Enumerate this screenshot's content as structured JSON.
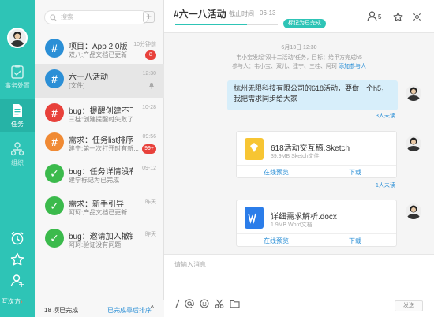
{
  "rail": {
    "nav": [
      {
        "label": "事务处置"
      },
      {
        "label": "任务"
      },
      {
        "label": "组织"
      }
    ],
    "footer_text": "互次方",
    "footer_arrow": "›",
    "accent": "#2ec4b6"
  },
  "list": {
    "search_placeholder": "搜索",
    "add_label": "+",
    "items": [
      {
        "icon": "#",
        "color": "#2b8fd6",
        "title": "项目：App 2.0版",
        "sub": "双八:产品文档已更新",
        "time": "10分钟前",
        "badge": "8"
      },
      {
        "icon": "#",
        "color": "#2b8fd6",
        "title": "六一八活动",
        "sub": "[文件]",
        "time": "12:30",
        "badge": ""
      },
      {
        "icon": "#",
        "color": "#e8413b",
        "title": "bug：提醒创建不了",
        "sub": "三桂:创建提醒时失败了...",
        "time": "10-28",
        "badge": ""
      },
      {
        "icon": "#",
        "color": "#f08a34",
        "title": "需求：任务list排序...",
        "sub": "建宁:第一次打开时有新...",
        "time": "09:56",
        "badge": "99+"
      },
      {
        "icon": "✓",
        "color": "#3bba4c",
        "title": "bug：任务详情没有...",
        "sub": "建宁标记为已完成",
        "time": "09-12",
        "badge": ""
      },
      {
        "icon": "✓",
        "color": "#3bba4c",
        "title": "需求：新手引导",
        "sub": "阿珂:产品文档已更新",
        "time": "昨天",
        "badge": ""
      },
      {
        "icon": "✓",
        "color": "#3bba4c",
        "title": "bug：邀请加入撤销...",
        "sub": "阿珂:验证没有问题",
        "time": "昨天",
        "badge": ""
      }
    ],
    "footer_count": "18 项已完成",
    "footer_sort": "已完成靠后排序",
    "footer_chevron": "^"
  },
  "header": {
    "title": "#六一八活动",
    "deadline_label": "截止时间",
    "deadline_value": "06-13",
    "status": "标记为已完成",
    "member_count": "5",
    "progress": 0.7
  },
  "chat": {
    "date": "6月13日 12:30",
    "sys1": "韦小宝发起\"双十二活动\"任务，目标：给甲方完成h5",
    "sys2_prefix": "参与人：韦小宝、双儿、建宁、三桂、阿珂",
    "sys2_link": "添加参与人",
    "message": "杭州无限科技有限公司的618活动，要做一个h5，我把需求同步给大家",
    "read1": "3人未读",
    "file1": {
      "name": "618活动交互稿.Sketch",
      "meta": "39.9MB  Sketch文件",
      "color": "#f7c533"
    },
    "read2": "1人未读",
    "file2": {
      "name": "详细需求解析.docx",
      "meta": "1.9MB  Word文档",
      "color": "#2b7de9"
    },
    "preview_label": "在线预览",
    "download_label": "下载"
  },
  "input": {
    "placeholder": "请输入消息",
    "send_label": "发送"
  }
}
